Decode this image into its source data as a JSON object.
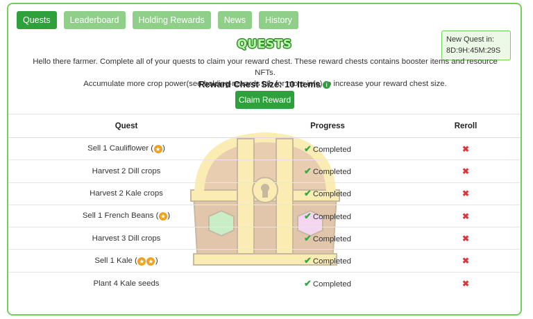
{
  "tabs": [
    {
      "label": "Quests",
      "active": true
    },
    {
      "label": "Leaderboard",
      "active": false
    },
    {
      "label": "Holding Rewards",
      "active": false
    },
    {
      "label": "News",
      "active": false
    },
    {
      "label": "History",
      "active": false
    }
  ],
  "timer": {
    "label": "New Quest in:",
    "value": "8D:9H:45M:29S"
  },
  "title": "QUESTS",
  "intro": {
    "line1": "Hello there farmer. Complete all of your quests to claim your reward chest. These reward chests contains booster items and resource NFTs.",
    "line2": "Accumulate more crop power(see holding-rewards tab for more info) to increase your reward chest size."
  },
  "chest_size": {
    "text": "Reward Chest Size: 10 Items",
    "info_icon": "info-icon"
  },
  "claim_button": "Claim Reward",
  "table": {
    "headers": {
      "quest": "Quest",
      "progress": "Progress",
      "reroll": "Reroll"
    },
    "rows": [
      {
        "quest": "Sell 1 Cauliflower",
        "stars": 1,
        "progress": "Completed"
      },
      {
        "quest": "Harvest 2 Dill crops",
        "stars": 0,
        "progress": "Completed"
      },
      {
        "quest": "Harvest 2 Kale crops",
        "stars": 0,
        "progress": "Completed"
      },
      {
        "quest": "Sell 1 French Beans",
        "stars": 1,
        "progress": "Completed"
      },
      {
        "quest": "Harvest 3 Dill crops",
        "stars": 0,
        "progress": "Completed"
      },
      {
        "quest": "Sell 1 Kale",
        "stars": 2,
        "progress": "Completed"
      },
      {
        "quest": "Plant 4 Kale seeds",
        "stars": 0,
        "progress": "Completed"
      }
    ],
    "progress_icon": "check-icon",
    "reroll_icon": "x-icon"
  },
  "colors": {
    "accent": "#2ea13c",
    "tab_inactive": "#8fcf8a",
    "frame": "#6fd15a",
    "reroll": "#d9363e",
    "star": "#f0a21d"
  }
}
